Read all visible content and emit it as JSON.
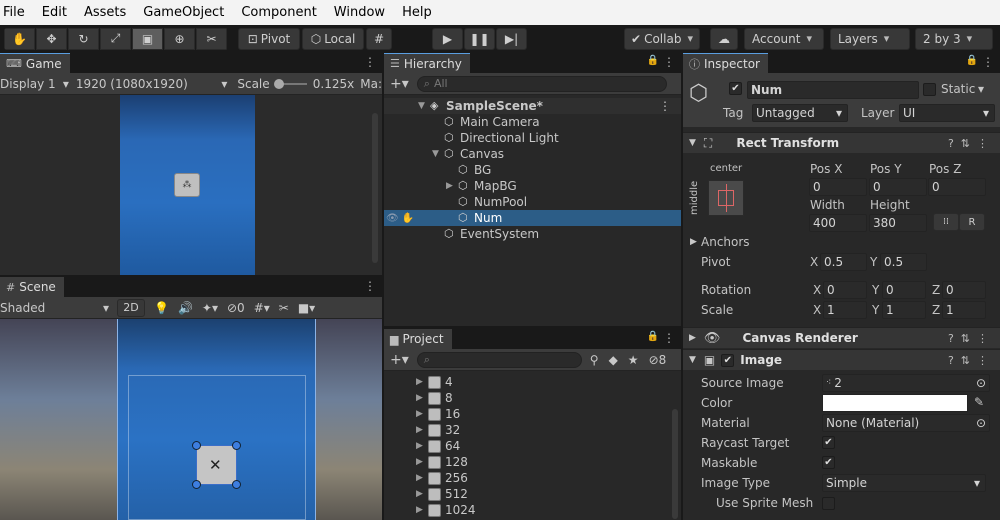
{
  "menu": [
    "File",
    "Edit",
    "Assets",
    "GameObject",
    "Component",
    "Window",
    "Help"
  ],
  "toolbar": {
    "pivot_label": "Pivot",
    "local_label": "Local",
    "collab_label": "Collab",
    "account_label": "Account",
    "layers_label": "Layers",
    "layout_label": "2 by 3"
  },
  "game": {
    "tab": "Game",
    "display": "Display 1",
    "resolution": "1920 (1080x1920)",
    "scale_label": "Scale",
    "scale_value": "0.125x",
    "max_label": "Ma:"
  },
  "scene": {
    "tab": "Scene",
    "shading": "Shaded",
    "mode_2d": "2D",
    "hidden_count": "0"
  },
  "hierarchy": {
    "tab": "Hierarchy",
    "search_placeholder": "All",
    "scene_name": "SampleScene*",
    "items": [
      {
        "label": "Main Camera",
        "depth": 1
      },
      {
        "label": "Directional Light",
        "depth": 1
      },
      {
        "label": "Canvas",
        "depth": 1,
        "expanded": true
      },
      {
        "label": "BG",
        "depth": 2
      },
      {
        "label": "MapBG",
        "depth": 2,
        "collapsed": true
      },
      {
        "label": "NumPool",
        "depth": 2
      },
      {
        "label": "Num",
        "depth": 2,
        "selected": true
      },
      {
        "label": "EventSystem",
        "depth": 1
      }
    ]
  },
  "project": {
    "tab": "Project",
    "hidden_count": "8",
    "items": [
      "4",
      "8",
      "16",
      "32",
      "64",
      "128",
      "256",
      "512",
      "1024"
    ]
  },
  "inspector": {
    "tab": "Inspector",
    "object_name": "Num",
    "static_label": "Static",
    "tag_label": "Tag",
    "tag_value": "Untagged",
    "layer_label": "Layer",
    "layer_value": "UI",
    "rect_transform": {
      "title": "Rect Transform",
      "anchor_h": "center",
      "anchor_v": "middle",
      "posx_label": "Pos X",
      "posy_label": "Pos Y",
      "posz_label": "Pos Z",
      "posx": "0",
      "posy": "0",
      "posz": "0",
      "width_label": "Width",
      "height_label": "Height",
      "width": "400",
      "height": "380",
      "r_label": "R",
      "anchors_label": "Anchors",
      "pivot_label": "Pivot",
      "pivot_x": "0.5",
      "pivot_y": "0.5",
      "rotation_label": "Rotation",
      "rot_x": "0",
      "rot_y": "0",
      "rot_z": "0",
      "scale_label": "Scale",
      "scale_x": "1",
      "scale_y": "1",
      "scale_z": "1",
      "x": "X",
      "y": "Y",
      "z": "Z"
    },
    "canvas_renderer": {
      "title": "Canvas Renderer"
    },
    "image": {
      "title": "Image",
      "source_image_label": "Source Image",
      "source_image": "2",
      "color_label": "Color",
      "material_label": "Material",
      "material": "None (Material)",
      "raycast_label": "Raycast Target",
      "maskable_label": "Maskable",
      "image_type_label": "Image Type",
      "image_type": "Simple",
      "use_sprite_mesh_label": "Use Sprite Mesh"
    }
  },
  "colors": {
    "accent": "#2c5d87",
    "panel": "#282828",
    "tab": "#3c3c3c"
  }
}
